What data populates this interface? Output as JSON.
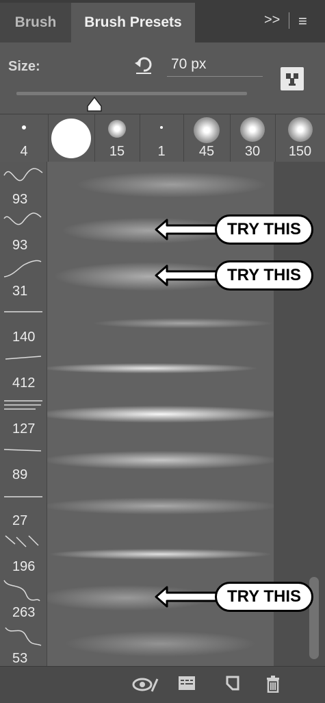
{
  "tabs": [
    {
      "label": "Brush"
    },
    {
      "label": "Brush Presets"
    }
  ],
  "panel_controls": {
    "expand": ">>",
    "menu": "≡"
  },
  "size": {
    "label": "Size:",
    "value": "70 px",
    "slider_fraction": 0.35
  },
  "brush_tips": [
    {
      "size": "4"
    },
    {
      "size": ""
    },
    {
      "size": "15"
    },
    {
      "size": "1"
    },
    {
      "size": "45"
    },
    {
      "size": "30"
    },
    {
      "size": "150"
    }
  ],
  "brush_list": [
    {
      "size": "93",
      "callout": ""
    },
    {
      "size": "93",
      "callout": "TRY THIS"
    },
    {
      "size": "31",
      "callout": "TRY THIS"
    },
    {
      "size": "140",
      "callout": ""
    },
    {
      "size": "412",
      "callout": ""
    },
    {
      "size": "127",
      "callout": ""
    },
    {
      "size": "89",
      "callout": ""
    },
    {
      "size": "27",
      "callout": ""
    },
    {
      "size": "196",
      "callout": ""
    },
    {
      "size": "263",
      "callout": "TRY THIS"
    },
    {
      "size": "53",
      "callout": ""
    }
  ],
  "bottom_icons": [
    "eye-brush-icon",
    "panel-icon",
    "new-preset-icon",
    "trash-icon"
  ]
}
